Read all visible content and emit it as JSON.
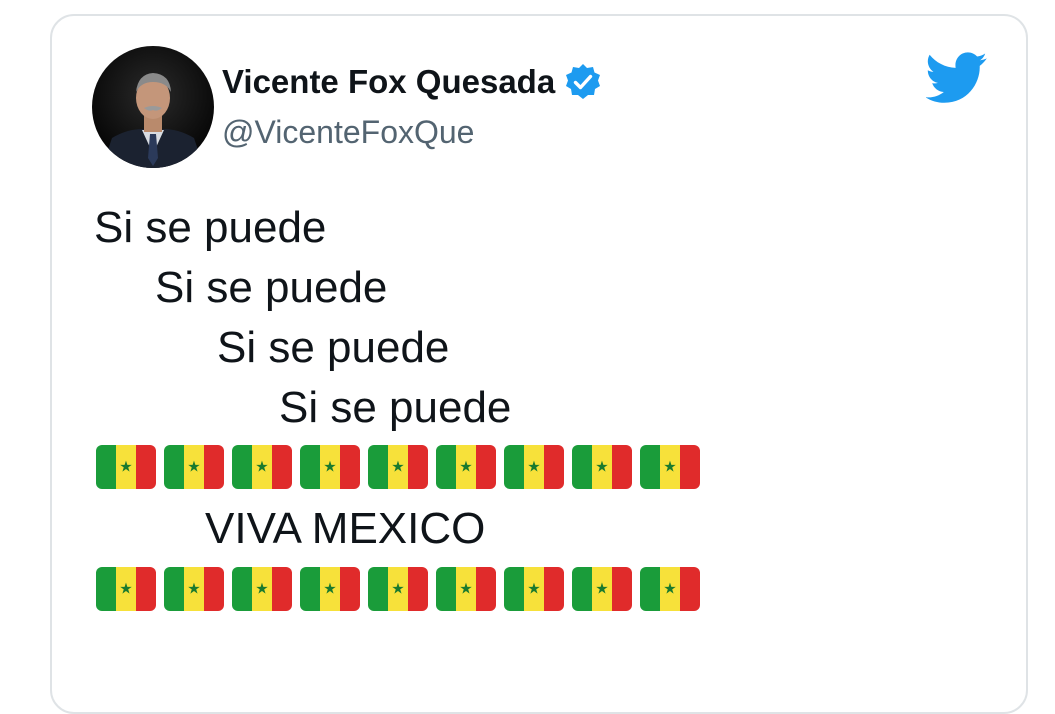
{
  "user": {
    "display_name": "Vicente Fox Quesada",
    "handle": "@VicenteFoxQue",
    "verified": true
  },
  "tweet": {
    "lines": [
      "Si se puede",
      "Si se puede",
      "Si se puede",
      "Si se puede"
    ],
    "flag_emoji": "🇸🇳",
    "flag_count_row1": 9,
    "viva_text": "VIVA MEXICO",
    "flag_count_row2": 9
  },
  "icons": {
    "verified": "verified-badge-icon",
    "platform": "twitter-bird-icon"
  },
  "colors": {
    "brand_blue": "#1d9bf0",
    "name_text": "#0f1419",
    "handle_text": "#536471",
    "flag_green": "#1a9c3a",
    "flag_yellow": "#f7e13a",
    "flag_red": "#e02b2b"
  }
}
